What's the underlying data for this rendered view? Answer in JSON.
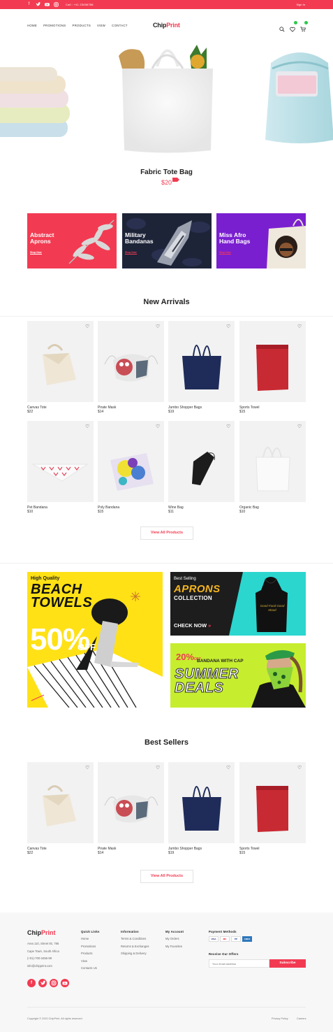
{
  "topbar": {
    "phone": "Call : +41 23456788",
    "signin": "Sign In",
    "social": [
      "facebook-icon",
      "twitter-icon",
      "youtube-icon",
      "instagram-icon"
    ],
    "accent": "#f23b52"
  },
  "nav": {
    "items": [
      "HOME",
      "PROMOTIONS",
      "PRODUCTS",
      "VIEW",
      "CONTACT"
    ],
    "logo_a": "Chip",
    "logo_b": "Print"
  },
  "hero": {
    "title": "Fabric Tote Bag",
    "price": "$20"
  },
  "promos": [
    {
      "line1": "Abstract",
      "line2": "Aprons",
      "link": "Shop Now",
      "color": "#f23b52"
    },
    {
      "line1": "Military",
      "line2": "Bandanas",
      "link": "Shop Now",
      "color": "#1e2438"
    },
    {
      "line1": "Miss Afro",
      "line2": "Hand Bags",
      "link": "Shop Now",
      "color": "#7a1fd0"
    }
  ],
  "new_arrivals": {
    "title": "New Arrivals",
    "products": [
      {
        "name": "Canvas Tote",
        "price": "$22"
      },
      {
        "name": "Pirate Mask",
        "price": "$14"
      },
      {
        "name": "Jumbo Shopper Bags",
        "price": "$19"
      },
      {
        "name": "Sports Towel",
        "price": "$15"
      },
      {
        "name": "Pet Bandana",
        "price": "$10"
      },
      {
        "name": "Poly Bandana",
        "price": "$15"
      },
      {
        "name": "Wine Bag",
        "price": "$11"
      },
      {
        "name": "Organic Bag",
        "price": "$10"
      }
    ],
    "button": "View All Products"
  },
  "banners": {
    "beach": {
      "top": "High Quality",
      "line1": "BEACH",
      "line2": "TOWELS",
      "pct": "50%",
      "off": "OFF"
    },
    "aprons": {
      "top": "Best Selling",
      "line1": "APRONS",
      "line2": "COLLECTION",
      "cta": "CHECK NOW",
      "script": "Good Food Good Mood"
    },
    "summer": {
      "pct": "20%",
      "off": "OFF",
      "sub": "BANDANA WITH CAP",
      "line1": "SUMMER",
      "line2": "DEALS"
    }
  },
  "best_sellers": {
    "title": "Best Sellers",
    "products": [
      {
        "name": "Canvas Tote",
        "price": "$22"
      },
      {
        "name": "Pirate Mask",
        "price": "$14"
      },
      {
        "name": "Jumbo Shopper Bags",
        "price": "$19"
      },
      {
        "name": "Sports Towel",
        "price": "$15"
      }
    ],
    "button": "View All Products"
  },
  "footer": {
    "logo_a": "Chip",
    "logo_b": "Print",
    "address": [
      "Area 110, Street 92, 786",
      "Cape Town, South Africa",
      "(+01)-700-3456-99",
      "info@chipprint.com"
    ],
    "quick_links": {
      "title": "Quick Links",
      "items": [
        "Home",
        "Promotions",
        "Products",
        "View",
        "Contacts Us"
      ]
    },
    "information": {
      "title": "Information",
      "items": [
        "Terms & Conditions",
        "Returns & Exchanges",
        "Shipping & Delivery"
      ]
    },
    "account": {
      "title": "My Account",
      "items": [
        "My Orders",
        "My Favorites"
      ]
    },
    "payment": {
      "title": "Payment Methods",
      "methods": [
        "VISA",
        "MC",
        "PP",
        "AMEX"
      ]
    },
    "offers": {
      "title": "Receive Our Offers",
      "placeholder": "Your email address",
      "button": "Subscribe"
    },
    "copyright": "Copyright © 2020 ChipPrint. All rights reserved",
    "privacy": "Privacy Policy",
    "careers": "Careers"
  }
}
